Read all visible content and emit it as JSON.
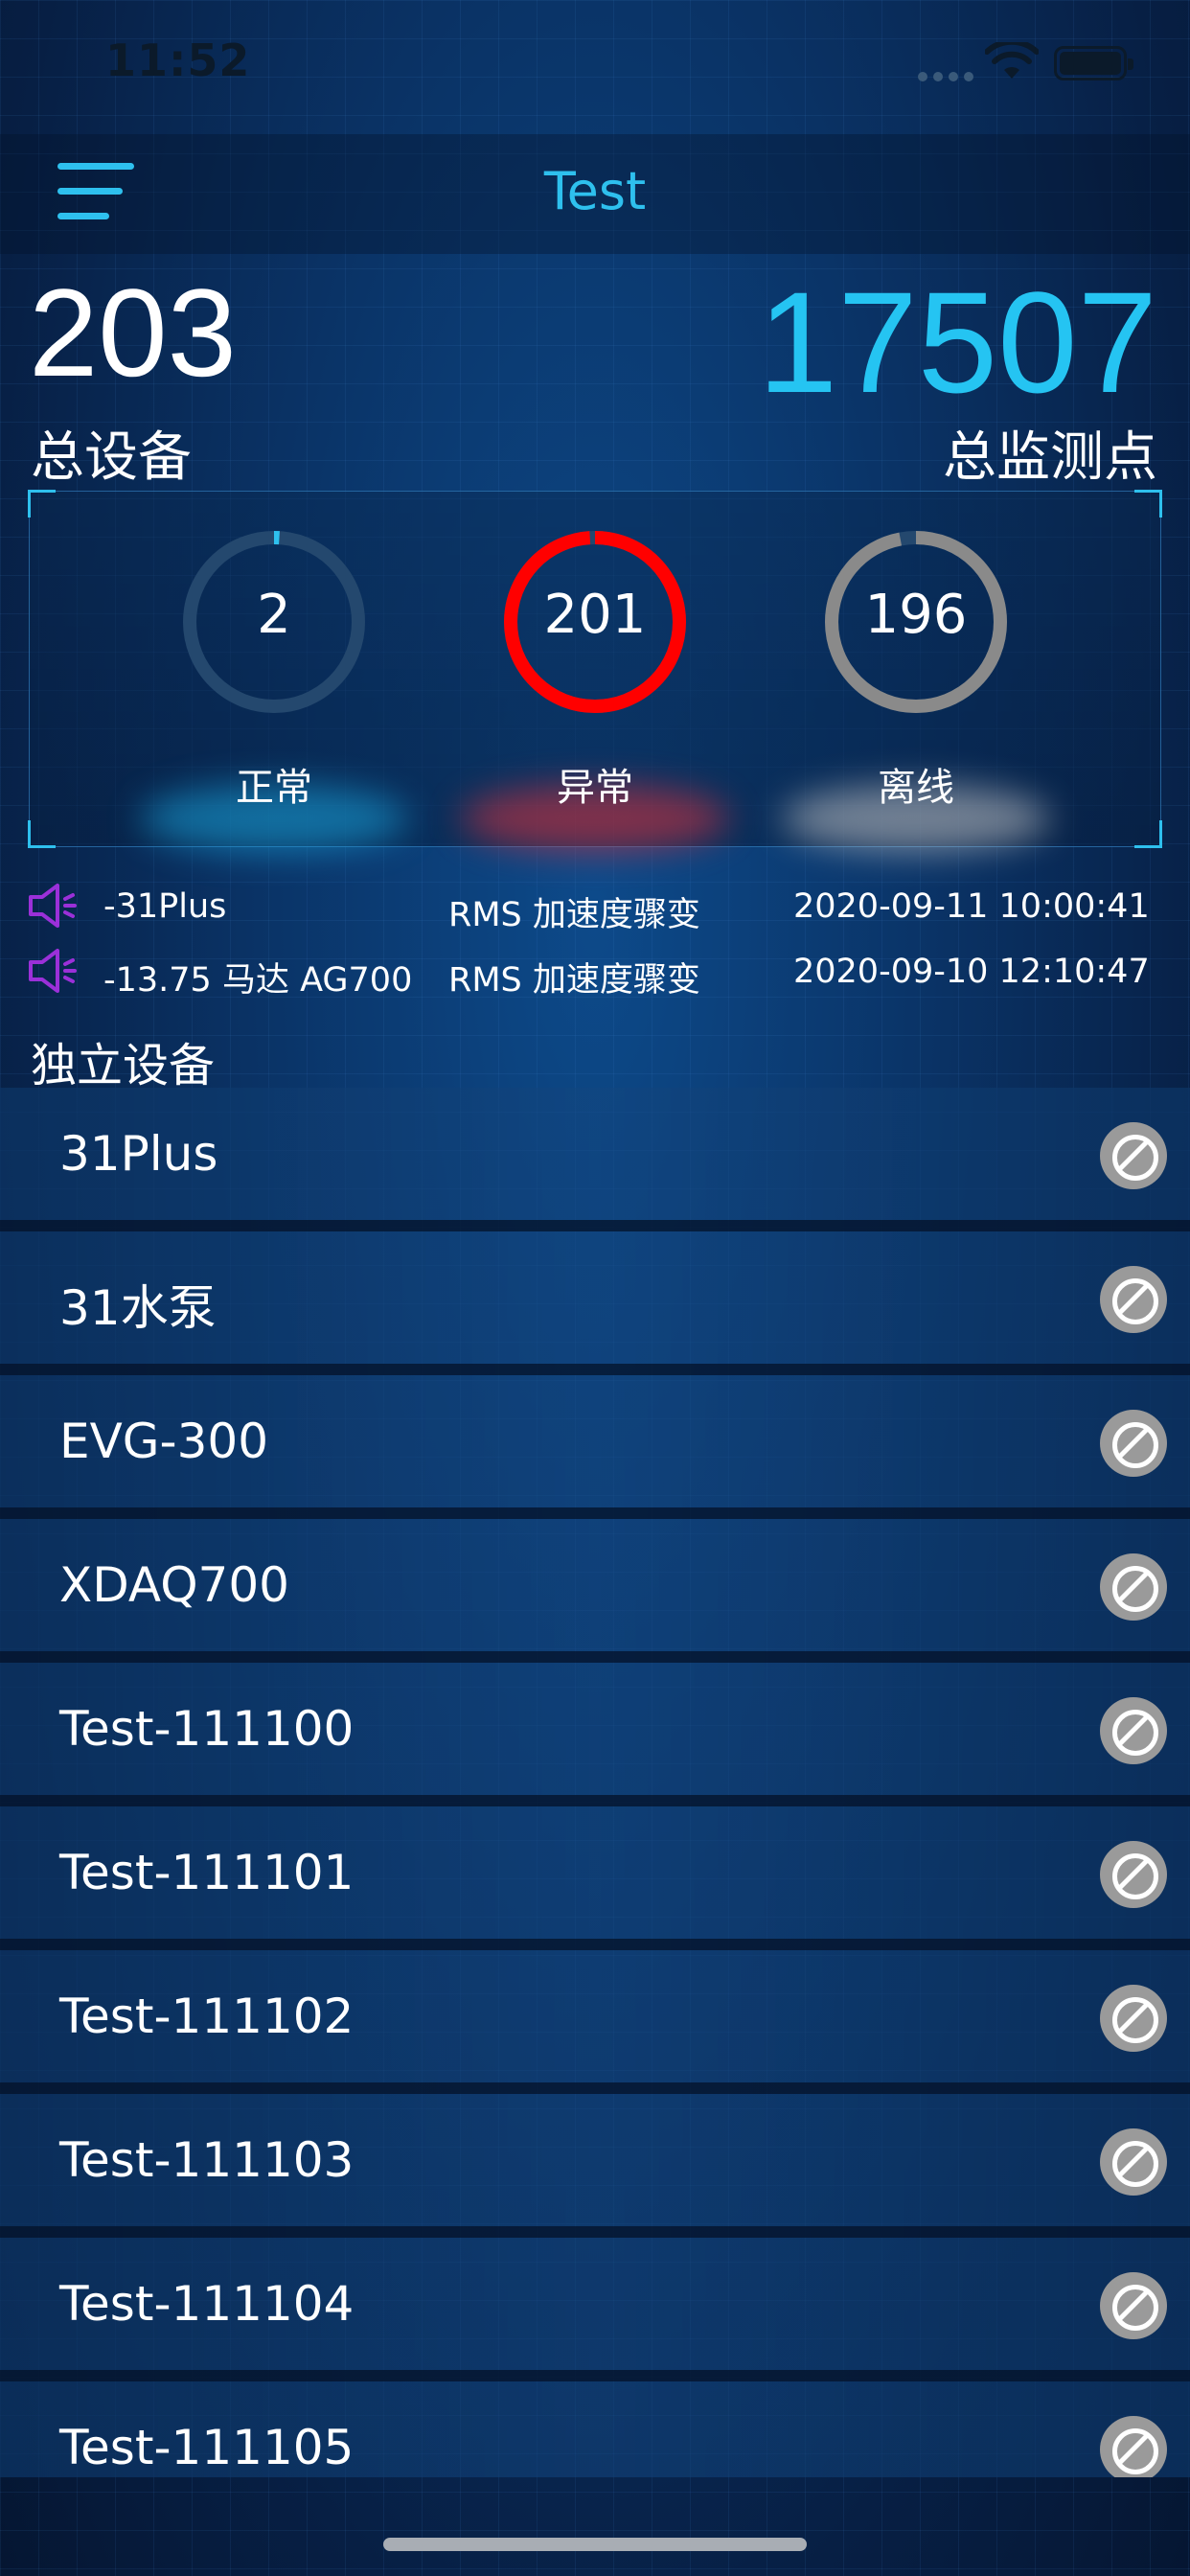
{
  "status_bar": {
    "time": "11:52"
  },
  "nav": {
    "title": "Test"
  },
  "summary": {
    "total_devices": "203",
    "total_devices_label": "总设备",
    "total_points": "17507",
    "total_points_label": "总监测点"
  },
  "status_rings": [
    {
      "value": "2",
      "label": "正常",
      "color": "#2ec0ee",
      "fraction": 0.01
    },
    {
      "value": "201",
      "label": "异常",
      "color": "#ff0000",
      "fraction": 0.99
    },
    {
      "value": "196",
      "label": "离线",
      "color": "#8a8a8a",
      "fraction": 0.97
    }
  ],
  "alerts": [
    {
      "device": "-31Plus",
      "type": "RMS 加速度骤变",
      "time": "2020-09-11 10:00:41"
    },
    {
      "device": "-13.75 马达 AG700",
      "type": "RMS 加速度骤变",
      "time": "2020-09-10 12:10:47"
    }
  ],
  "section_title": "独立设备",
  "devices": [
    {
      "name": "31Plus"
    },
    {
      "name": "31水泵"
    },
    {
      "name": "EVG-300"
    },
    {
      "name": "XDAQ700"
    },
    {
      "name": "Test-111100"
    },
    {
      "name": "Test-111101"
    },
    {
      "name": "Test-111102"
    },
    {
      "name": "Test-111103"
    },
    {
      "name": "Test-111104"
    },
    {
      "name": "Test-111105"
    }
  ],
  "colors": {
    "accent": "#2ec0ee",
    "abnormal": "#ff0000",
    "offline": "#8a8a8a",
    "alert_icon": "#9b30d9"
  },
  "icons": {
    "menu": "menu-icon",
    "alert": "speaker-icon",
    "device_status": "disabled-icon"
  }
}
